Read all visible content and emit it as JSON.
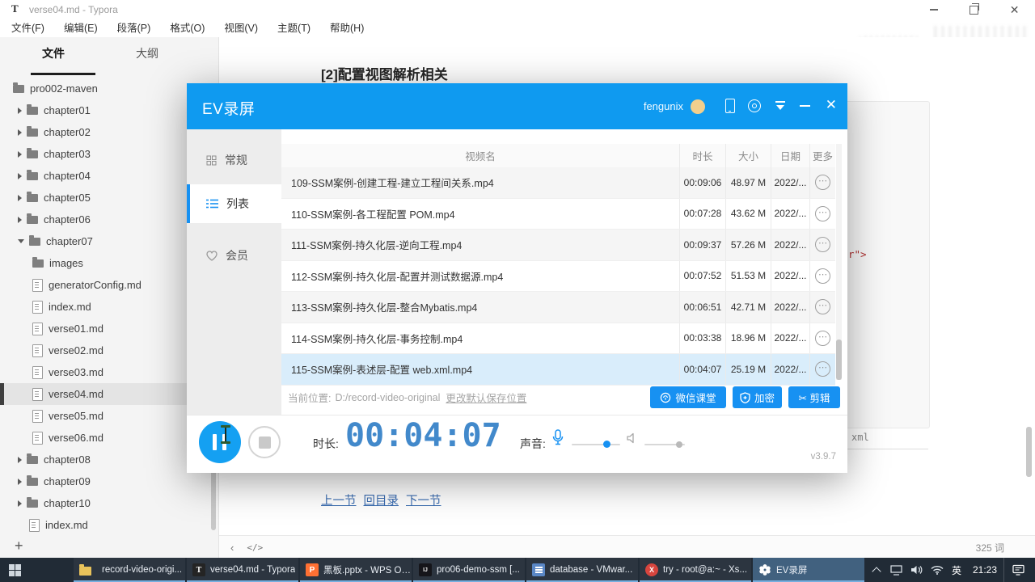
{
  "typora": {
    "titlebar": {
      "app_initial": "T",
      "title": "verse04.md - Typora"
    },
    "menu": {
      "items": [
        "文件(F)",
        "编辑(E)",
        "段落(P)",
        "格式(O)",
        "视图(V)",
        "主题(T)",
        "帮助(H)"
      ]
    },
    "sidebar": {
      "tabs": {
        "files": "文件",
        "outline": "大纲"
      },
      "tree": [
        "pro002-maven",
        "chapter01",
        "chapter02",
        "chapter03",
        "chapter04",
        "chapter05",
        "chapter06",
        "chapter07",
        "images",
        "generatorConfig.md",
        "index.md",
        "verse01.md",
        "verse02.md",
        "verse03.md",
        "verse04.md",
        "verse05.md",
        "verse06.md",
        "chapter08",
        "chapter09",
        "chapter10",
        "index.md"
      ],
      "new_file_button": "+"
    },
    "editor": {
      "heading": "[2]配置视图解析相关",
      "code_fragment": "r\">",
      "code_lang": "xml",
      "links": [
        "上一节",
        "回目录",
        "下一节"
      ]
    },
    "statusbar": {
      "back_icon": "‹",
      "source_mode_icon": "</>",
      "word_count": "325 词"
    }
  },
  "ev_dialog": {
    "title": "EV录屏",
    "username": "fengunix",
    "version": "v3.9.7",
    "nav": [
      "常规",
      "列表",
      "会员"
    ],
    "table": {
      "headers": [
        "视频名",
        "时长",
        "大小",
        "日期",
        "更多"
      ],
      "rows": [
        {
          "name": "109-SSM案例-创建工程-建立工程间关系.mp4",
          "duration": "00:09:06",
          "size": "48.97 M",
          "date": "2022/..."
        },
        {
          "name": "110-SSM案例-各工程配置 POM.mp4",
          "duration": "00:07:28",
          "size": "43.62 M",
          "date": "2022/..."
        },
        {
          "name": "111-SSM案例-持久化层-逆向工程.mp4",
          "duration": "00:09:37",
          "size": "57.26 M",
          "date": "2022/..."
        },
        {
          "name": "112-SSM案例-持久化层-配置并测试数据源.mp4",
          "duration": "00:07:52",
          "size": "51.53 M",
          "date": "2022/..."
        },
        {
          "name": "113-SSM案例-持久化层-整合Mybatis.mp4",
          "duration": "00:06:51",
          "size": "42.71 M",
          "date": "2022/..."
        },
        {
          "name": "114-SSM案例-持久化层-事务控制.mp4",
          "duration": "00:03:38",
          "size": "18.96 M",
          "date": "2022/..."
        },
        {
          "name": "115-SSM案例-表述层-配置 web.xml.mp4",
          "duration": "00:04:07",
          "size": "25.19 M",
          "date": "2022/..."
        }
      ],
      "more_icon": "⋯"
    },
    "location": {
      "label": "当前位置:",
      "path": "D:/record-video-original",
      "change_link": "更改默认保存位置"
    },
    "actions": {
      "wechat": "微信课堂",
      "encrypt": "加密",
      "clip": "✂ 剪辑"
    },
    "controls": {
      "duration_label": "时长:",
      "time": "00:04:07",
      "sound_label": "声音:"
    }
  },
  "taskbar": {
    "items": [
      "record-video-origi...",
      "verse04.md - Typora",
      "黑板.pptx - WPS Of...",
      "pro06-demo-ssm [...",
      "database - VMwar...",
      "try - root@a:~ - Xs...",
      "EV录屏"
    ],
    "tray": {
      "lang": "英",
      "time": "21:23"
    }
  }
}
